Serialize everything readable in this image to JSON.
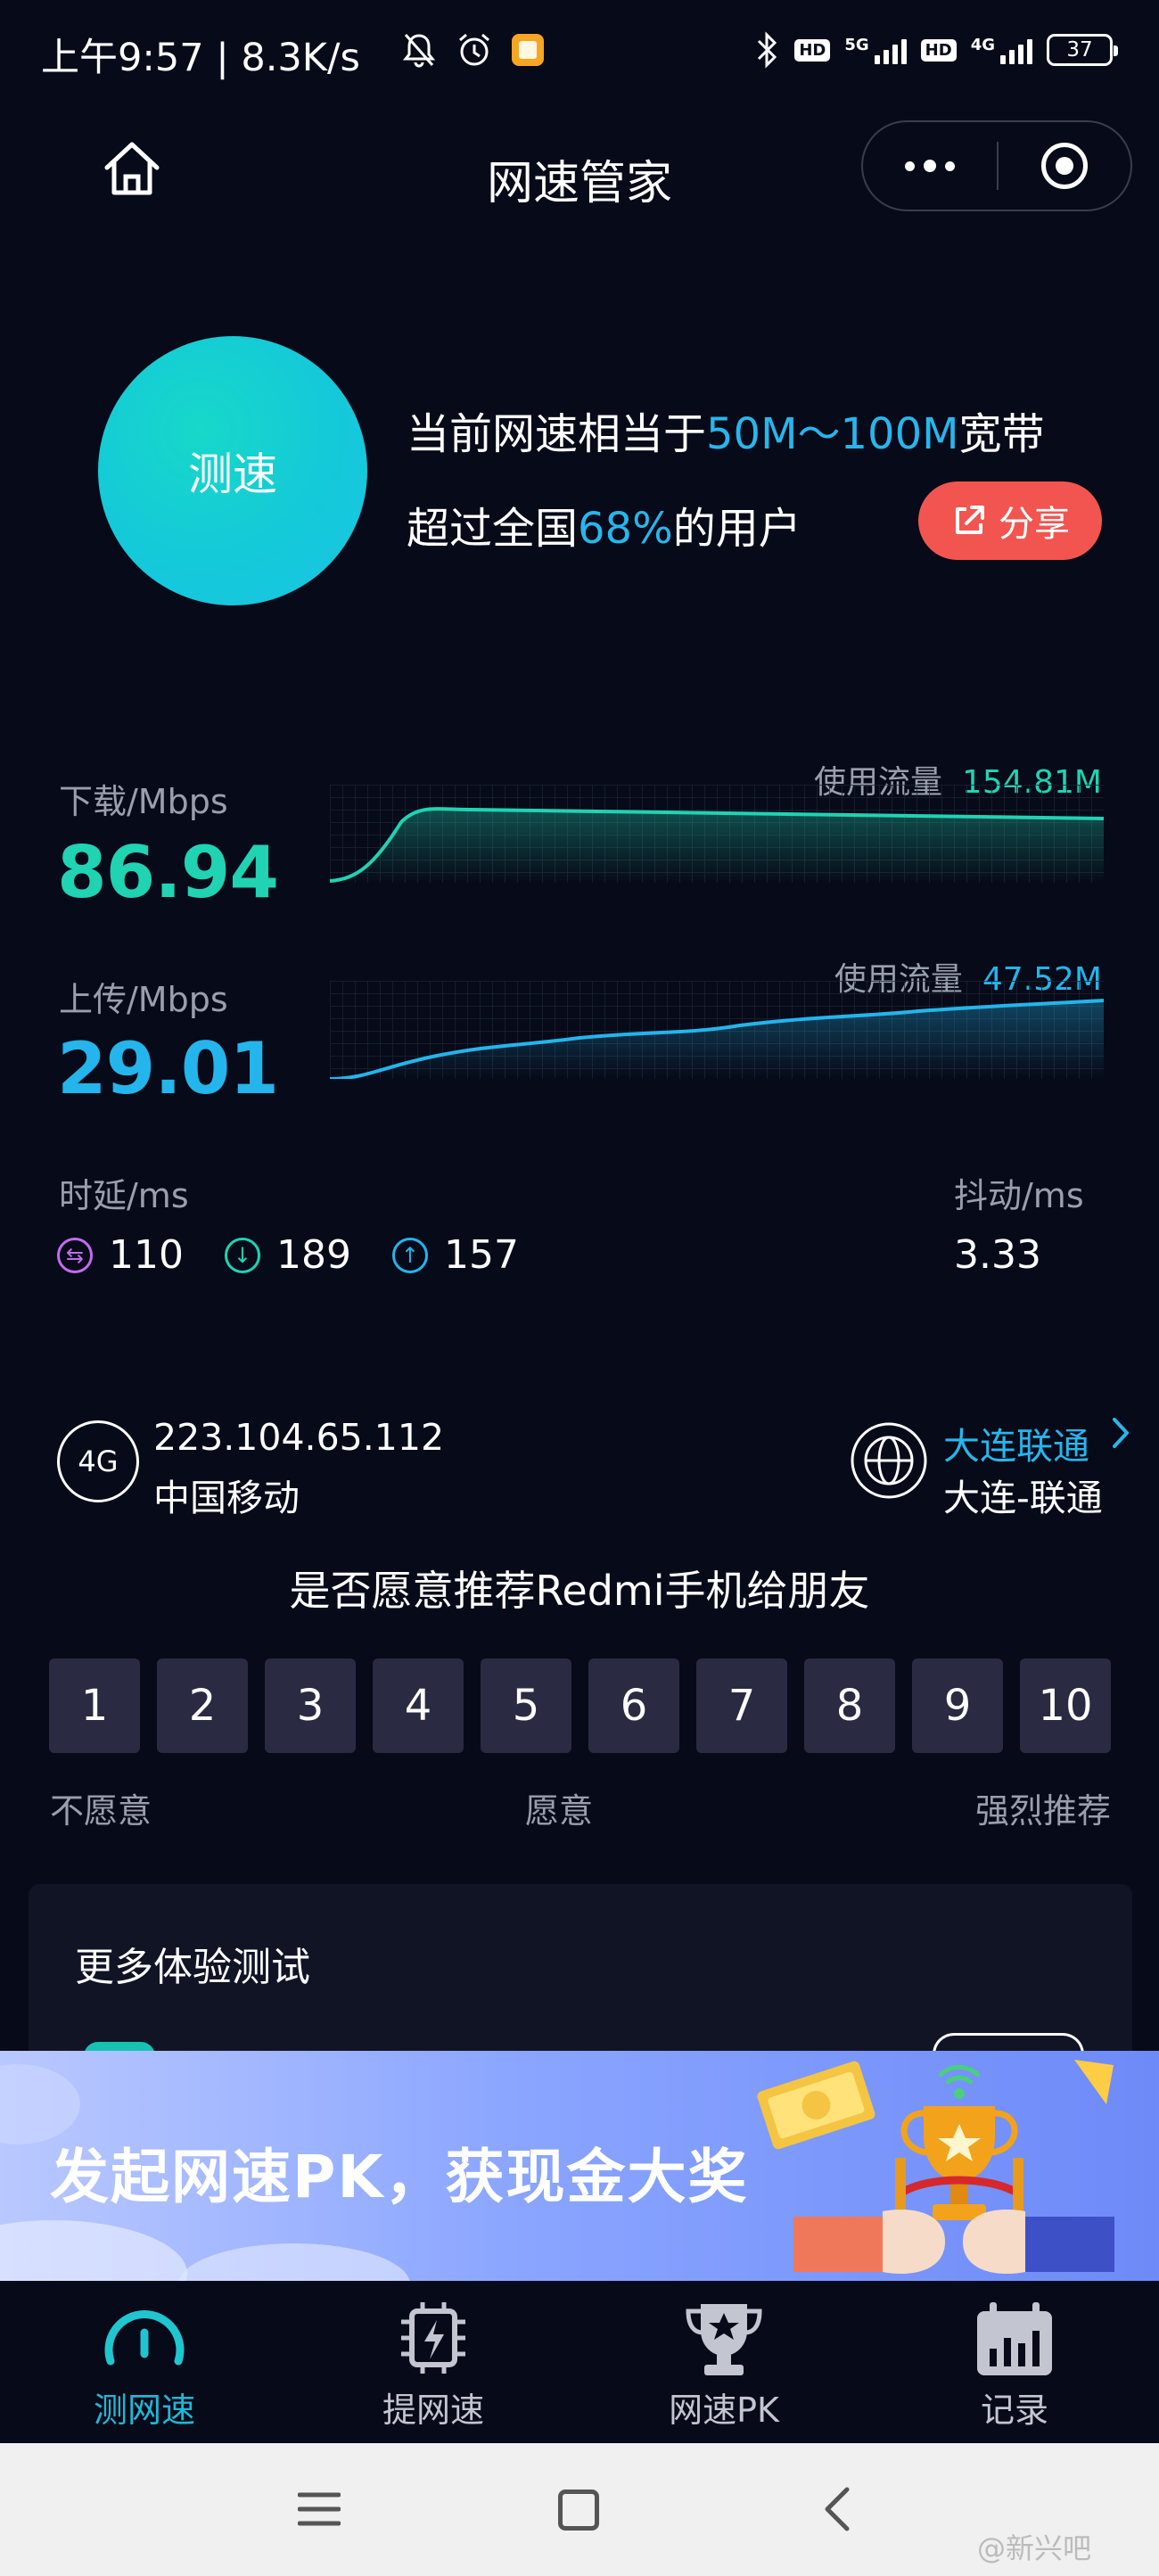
{
  "status_bar": {
    "time_speed": "上午9:57 | 8.3K/s",
    "net_5g": "5G",
    "net_4g": "4G",
    "hd": "HD",
    "battery": "37"
  },
  "nav": {
    "title": "网速管家"
  },
  "summary": {
    "button": "测速",
    "line1_prefix": "当前网速相当于",
    "line1_highlight": "50M～100M",
    "line1_suffix": "宽带",
    "line2_prefix": "超过全国",
    "line2_highlight": "68%",
    "line2_suffix": "的用户",
    "share_label": "分享"
  },
  "download": {
    "label": "下载/Mbps",
    "value": "86.94",
    "traffic_label": "使用流量",
    "traffic_value": "154.81M",
    "color": "#1fd3b3"
  },
  "upload": {
    "label": "上传/Mbps",
    "value": "29.01",
    "traffic_label": "使用流量",
    "traffic_value": "47.52M",
    "color": "#23b5ec"
  },
  "latency": {
    "label": "时延/ms",
    "values": [
      "110",
      "189",
      "157"
    ]
  },
  "jitter": {
    "label": "抖动/ms",
    "value": "3.33"
  },
  "network": {
    "type": "4G",
    "ip": "223.104.65.112",
    "carrier": "中国移动",
    "node_link": "大连联通",
    "node_name": "大连-联通"
  },
  "survey": {
    "question": "是否愿意推荐Redmi手机给朋友",
    "scores": [
      "1",
      "2",
      "3",
      "4",
      "5",
      "6",
      "7",
      "8",
      "9",
      "10"
    ],
    "low_label": "不愿意",
    "mid_label": "愿意",
    "high_label": "强烈推荐"
  },
  "more_tests": {
    "title": "更多体验测试"
  },
  "banner": {
    "text": "发起网速PK，获现金大奖"
  },
  "tabs": [
    {
      "label": "测网速",
      "icon": "speedometer-icon",
      "active": true
    },
    {
      "label": "提网速",
      "icon": "chip-boost-icon",
      "active": false
    },
    {
      "label": "网速PK",
      "icon": "trophy-icon",
      "active": false
    },
    {
      "label": "记录",
      "icon": "records-icon",
      "active": false
    }
  ],
  "watermark": "@新兴吧"
}
